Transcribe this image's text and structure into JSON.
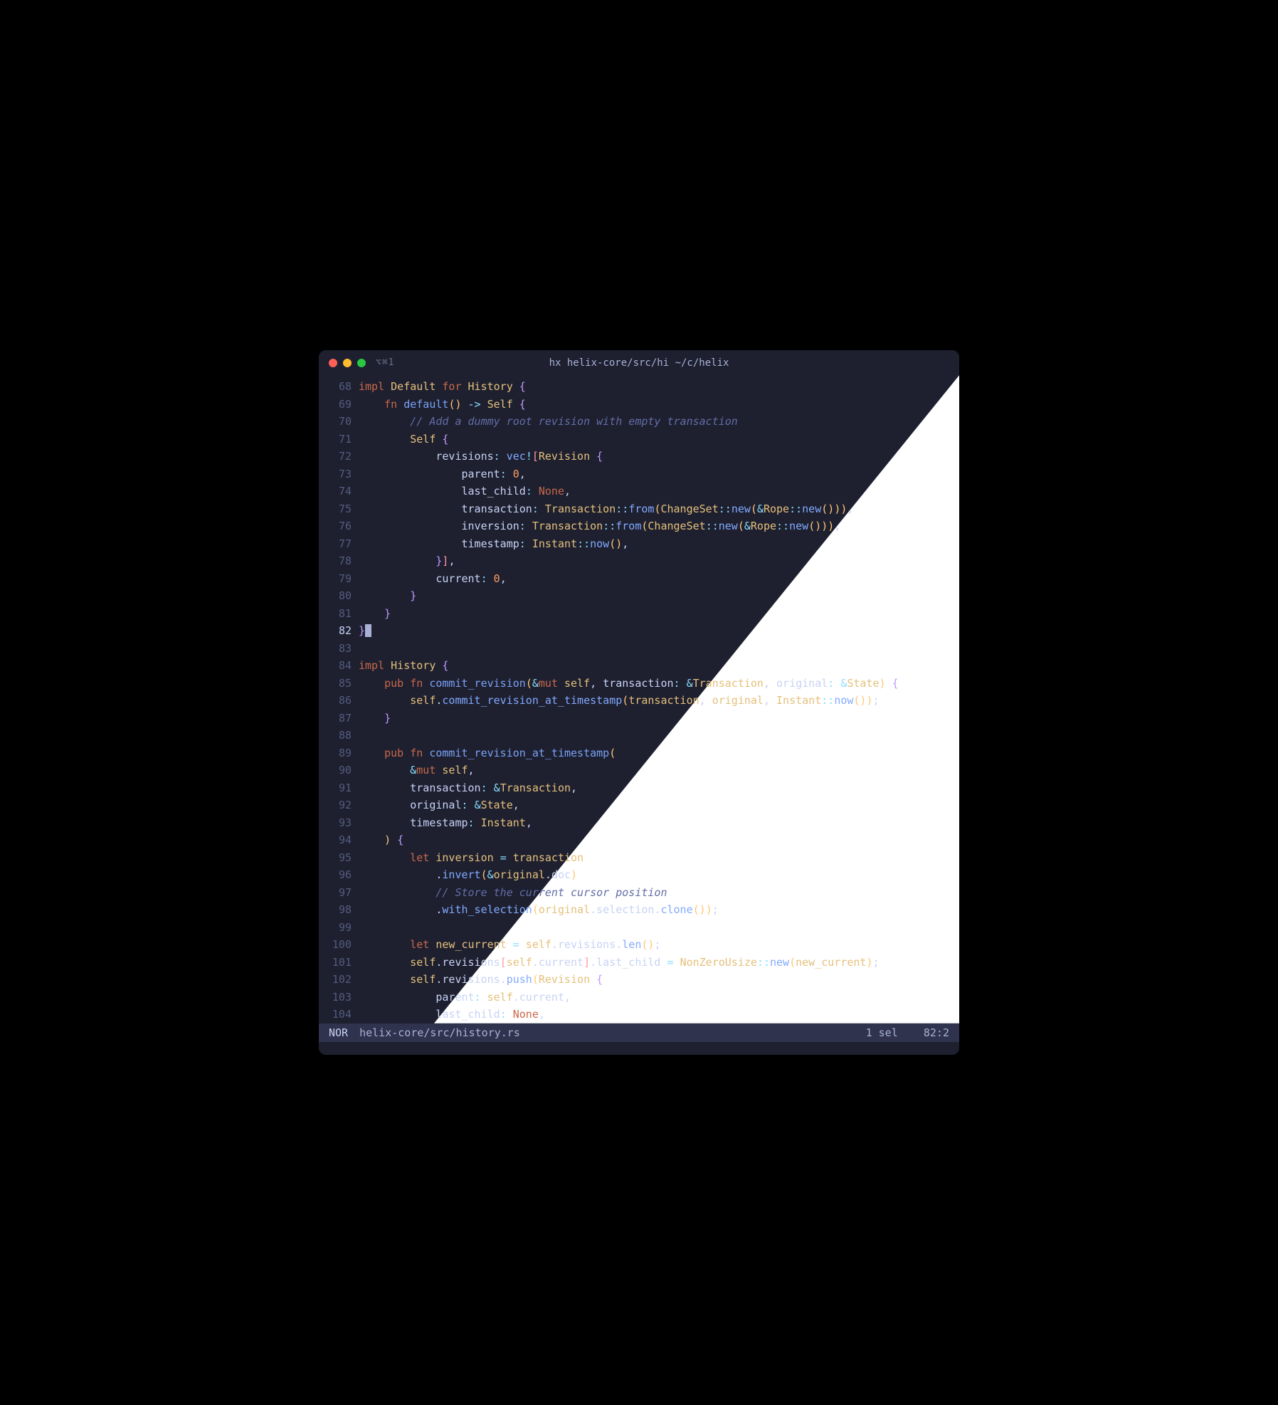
{
  "window": {
    "tab_indicator": "⌥⌘1",
    "title": "hx helix-core/src/hi ~/c/helix"
  },
  "statusbar": {
    "mode": "NOR",
    "filepath": "helix-core/src/history.rs",
    "selections": "1 sel",
    "position": "82:2"
  },
  "lines": [
    {
      "num": "68",
      "tokens": [
        [
          "kw",
          "impl"
        ],
        [
          "",
          " "
        ],
        [
          "ty",
          "Default"
        ],
        [
          "",
          " "
        ],
        [
          "kw",
          "for"
        ],
        [
          "",
          " "
        ],
        [
          "ty",
          "History"
        ],
        [
          "",
          " "
        ],
        [
          "brace",
          "{"
        ]
      ]
    },
    {
      "num": "69",
      "tokens": [
        [
          "",
          "    "
        ],
        [
          "kw",
          "fn"
        ],
        [
          "",
          " "
        ],
        [
          "fnname",
          "default"
        ],
        [
          "paren",
          "()"
        ],
        [
          "",
          " "
        ],
        [
          "punct",
          "->"
        ],
        [
          "",
          " "
        ],
        [
          "ty",
          "Self"
        ],
        [
          "",
          " "
        ],
        [
          "brace",
          "{"
        ]
      ]
    },
    {
      "num": "70",
      "tokens": [
        [
          "",
          "        "
        ],
        [
          "comment",
          "// Add a dummy root revision with empty transaction"
        ]
      ]
    },
    {
      "num": "71",
      "tokens": [
        [
          "",
          "        "
        ],
        [
          "ty",
          "Self"
        ],
        [
          "",
          " "
        ],
        [
          "brace",
          "{"
        ]
      ]
    },
    {
      "num": "72",
      "tokens": [
        [
          "",
          "            "
        ],
        [
          "field",
          "revisions"
        ],
        [
          "punct",
          ":"
        ],
        [
          "",
          " "
        ],
        [
          "fncall",
          "vec"
        ],
        [
          "punct",
          "!"
        ],
        [
          "bracket",
          "["
        ],
        [
          "ty",
          "Revision"
        ],
        [
          "",
          " "
        ],
        [
          "brace",
          "{"
        ]
      ]
    },
    {
      "num": "73",
      "tokens": [
        [
          "",
          "                "
        ],
        [
          "field",
          "parent"
        ],
        [
          "punct",
          ":"
        ],
        [
          "",
          " "
        ],
        [
          "num",
          "0"
        ],
        [
          "",
          ","
        ]
      ]
    },
    {
      "num": "74",
      "tokens": [
        [
          "",
          "                "
        ],
        [
          "field",
          "last_child"
        ],
        [
          "punct",
          ":"
        ],
        [
          "",
          " "
        ],
        [
          "none",
          "None"
        ],
        [
          "",
          ","
        ]
      ]
    },
    {
      "num": "75",
      "tokens": [
        [
          "",
          "                "
        ],
        [
          "field",
          "transaction"
        ],
        [
          "punct",
          ":"
        ],
        [
          "",
          " "
        ],
        [
          "ty",
          "Transaction"
        ],
        [
          "punct",
          "::"
        ],
        [
          "fncall",
          "from"
        ],
        [
          "paren",
          "("
        ],
        [
          "ty",
          "ChangeSet"
        ],
        [
          "punct",
          "::"
        ],
        [
          "fncall",
          "new"
        ],
        [
          "paren",
          "("
        ],
        [
          "punct",
          "&"
        ],
        [
          "ty",
          "Rope"
        ],
        [
          "punct",
          "::"
        ],
        [
          "fncall",
          "new"
        ],
        [
          "paren",
          "()"
        ],
        [
          "paren",
          ")"
        ],
        [
          "paren",
          ")"
        ],
        [
          "",
          ","
        ]
      ]
    },
    {
      "num": "76",
      "tokens": [
        [
          "",
          "                "
        ],
        [
          "field",
          "inversion"
        ],
        [
          "punct",
          ":"
        ],
        [
          "",
          " "
        ],
        [
          "ty",
          "Transaction"
        ],
        [
          "punct",
          "::"
        ],
        [
          "fncall",
          "from"
        ],
        [
          "paren",
          "("
        ],
        [
          "ty",
          "ChangeSet"
        ],
        [
          "punct",
          "::"
        ],
        [
          "fncall",
          "new"
        ],
        [
          "paren",
          "("
        ],
        [
          "punct",
          "&"
        ],
        [
          "ty",
          "Rope"
        ],
        [
          "punct",
          "::"
        ],
        [
          "fncall",
          "new"
        ],
        [
          "paren",
          "()"
        ],
        [
          "paren",
          ")"
        ],
        [
          "paren",
          ")"
        ],
        [
          "",
          ","
        ]
      ]
    },
    {
      "num": "77",
      "tokens": [
        [
          "",
          "                "
        ],
        [
          "field",
          "timestamp"
        ],
        [
          "punct",
          ":"
        ],
        [
          "",
          " "
        ],
        [
          "ty",
          "Instant"
        ],
        [
          "punct",
          "::"
        ],
        [
          "fncall",
          "now"
        ],
        [
          "paren",
          "()"
        ],
        [
          "",
          ","
        ]
      ]
    },
    {
      "num": "78",
      "tokens": [
        [
          "",
          "            "
        ],
        [
          "brace",
          "}"
        ],
        [
          "bracket",
          "]"
        ],
        [
          "",
          ","
        ]
      ]
    },
    {
      "num": "79",
      "tokens": [
        [
          "",
          "            "
        ],
        [
          "field",
          "current"
        ],
        [
          "punct",
          ":"
        ],
        [
          "",
          " "
        ],
        [
          "num",
          "0"
        ],
        [
          "",
          ","
        ]
      ]
    },
    {
      "num": "80",
      "tokens": [
        [
          "",
          "        "
        ],
        [
          "brace",
          "}"
        ]
      ]
    },
    {
      "num": "81",
      "tokens": [
        [
          "",
          "    "
        ],
        [
          "brace",
          "}"
        ]
      ]
    },
    {
      "num": "82",
      "cursor": true,
      "tokens": [
        [
          "brace",
          "}"
        ],
        [
          "cursor",
          " "
        ]
      ]
    },
    {
      "num": "83",
      "tokens": []
    },
    {
      "num": "84",
      "tokens": [
        [
          "kw",
          "impl"
        ],
        [
          "",
          " "
        ],
        [
          "ty",
          "History"
        ],
        [
          "",
          " "
        ],
        [
          "brace",
          "{"
        ]
      ]
    },
    {
      "num": "85",
      "tokens": [
        [
          "",
          "    "
        ],
        [
          "kw",
          "pub"
        ],
        [
          "",
          " "
        ],
        [
          "kw",
          "fn"
        ],
        [
          "",
          " "
        ],
        [
          "fnname",
          "commit_revision"
        ],
        [
          "paren",
          "("
        ],
        [
          "punct",
          "&"
        ],
        [
          "kw",
          "mut"
        ],
        [
          "",
          " "
        ],
        [
          "slf",
          "self"
        ],
        [
          "",
          ","
        ],
        [
          "",
          " "
        ],
        [
          "field",
          "transaction"
        ],
        [
          "punct",
          ":"
        ],
        [
          "",
          " "
        ],
        [
          "punct",
          "&"
        ],
        [
          "ty",
          "Transaction"
        ],
        [
          "",
          ","
        ],
        [
          "",
          " "
        ],
        [
          "field",
          "original"
        ],
        [
          "punct",
          ":"
        ],
        [
          "",
          " "
        ],
        [
          "punct",
          "&"
        ],
        [
          "ty",
          "State"
        ],
        [
          "paren",
          ")"
        ],
        [
          "",
          " "
        ],
        [
          "brace",
          "{"
        ]
      ]
    },
    {
      "num": "86",
      "tokens": [
        [
          "",
          "        "
        ],
        [
          "slf",
          "self"
        ],
        [
          "",
          "."
        ],
        [
          "fncall",
          "commit_revision_at_timestamp"
        ],
        [
          "paren",
          "("
        ],
        [
          "var",
          "transaction"
        ],
        [
          "",
          ","
        ],
        [
          "",
          " "
        ],
        [
          "var",
          "original"
        ],
        [
          "",
          ","
        ],
        [
          "",
          " "
        ],
        [
          "ty",
          "Instant"
        ],
        [
          "punct",
          "::"
        ],
        [
          "fncall",
          "now"
        ],
        [
          "paren",
          "()"
        ],
        [
          "paren",
          ")"
        ],
        [
          "",
          ";"
        ]
      ]
    },
    {
      "num": "87",
      "tokens": [
        [
          "",
          "    "
        ],
        [
          "brace",
          "}"
        ]
      ]
    },
    {
      "num": "88",
      "tokens": []
    },
    {
      "num": "89",
      "tokens": [
        [
          "",
          "    "
        ],
        [
          "kw",
          "pub"
        ],
        [
          "",
          " "
        ],
        [
          "kw",
          "fn"
        ],
        [
          "",
          " "
        ],
        [
          "fnname",
          "commit_revision_at_timestamp"
        ],
        [
          "paren",
          "("
        ]
      ]
    },
    {
      "num": "90",
      "tokens": [
        [
          "",
          "        "
        ],
        [
          "punct",
          "&"
        ],
        [
          "kw",
          "mut"
        ],
        [
          "",
          " "
        ],
        [
          "slf",
          "self"
        ],
        [
          "",
          ","
        ]
      ]
    },
    {
      "num": "91",
      "tokens": [
        [
          "",
          "        "
        ],
        [
          "field",
          "transaction"
        ],
        [
          "punct",
          ":"
        ],
        [
          "",
          " "
        ],
        [
          "punct",
          "&"
        ],
        [
          "ty",
          "Transaction"
        ],
        [
          "",
          ","
        ]
      ]
    },
    {
      "num": "92",
      "tokens": [
        [
          "",
          "        "
        ],
        [
          "field",
          "original"
        ],
        [
          "punct",
          ":"
        ],
        [
          "",
          " "
        ],
        [
          "punct",
          "&"
        ],
        [
          "ty",
          "State"
        ],
        [
          "",
          ","
        ]
      ]
    },
    {
      "num": "93",
      "tokens": [
        [
          "",
          "        "
        ],
        [
          "field",
          "timestamp"
        ],
        [
          "punct",
          ":"
        ],
        [
          "",
          " "
        ],
        [
          "ty",
          "Instant"
        ],
        [
          "",
          ","
        ]
      ]
    },
    {
      "num": "94",
      "tokens": [
        [
          "",
          "    "
        ],
        [
          "paren",
          ")"
        ],
        [
          "",
          " "
        ],
        [
          "brace",
          "{"
        ]
      ]
    },
    {
      "num": "95",
      "tokens": [
        [
          "",
          "        "
        ],
        [
          "kw",
          "let"
        ],
        [
          "",
          " "
        ],
        [
          "var",
          "inversion"
        ],
        [
          "",
          " "
        ],
        [
          "punct",
          "="
        ],
        [
          "",
          " "
        ],
        [
          "var",
          "transaction"
        ]
      ]
    },
    {
      "num": "96",
      "tokens": [
        [
          "",
          "            "
        ],
        [
          "",
          "."
        ],
        [
          "fncall",
          "invert"
        ],
        [
          "paren",
          "("
        ],
        [
          "punct",
          "&"
        ],
        [
          "var",
          "original"
        ],
        [
          "",
          "."
        ],
        [
          "field",
          "doc"
        ],
        [
          "paren",
          ")"
        ]
      ]
    },
    {
      "num": "97",
      "tokens": [
        [
          "",
          "            "
        ],
        [
          "comment",
          "// Store the current cursor position"
        ]
      ]
    },
    {
      "num": "98",
      "tokens": [
        [
          "",
          "            "
        ],
        [
          "",
          "."
        ],
        [
          "fncall",
          "with_selection"
        ],
        [
          "paren",
          "("
        ],
        [
          "var",
          "original"
        ],
        [
          "",
          "."
        ],
        [
          "field",
          "selection"
        ],
        [
          "",
          "."
        ],
        [
          "fncall",
          "clone"
        ],
        [
          "paren",
          "()"
        ],
        [
          "paren",
          ")"
        ],
        [
          "",
          ";"
        ]
      ]
    },
    {
      "num": "99",
      "tokens": []
    },
    {
      "num": "100",
      "tokens": [
        [
          "",
          "        "
        ],
        [
          "kw",
          "let"
        ],
        [
          "",
          " "
        ],
        [
          "var",
          "new_current"
        ],
        [
          "",
          " "
        ],
        [
          "punct",
          "="
        ],
        [
          "",
          " "
        ],
        [
          "slf",
          "self"
        ],
        [
          "",
          "."
        ],
        [
          "field",
          "revisions"
        ],
        [
          "",
          "."
        ],
        [
          "fncall",
          "len"
        ],
        [
          "paren",
          "()"
        ],
        [
          "",
          ";"
        ]
      ]
    },
    {
      "num": "101",
      "tokens": [
        [
          "",
          "        "
        ],
        [
          "slf",
          "self"
        ],
        [
          "",
          "."
        ],
        [
          "field",
          "revisions"
        ],
        [
          "bracket",
          "["
        ],
        [
          "slf",
          "self"
        ],
        [
          "",
          "."
        ],
        [
          "field",
          "current"
        ],
        [
          "bracket",
          "]"
        ],
        [
          "",
          "."
        ],
        [
          "field",
          "last_child"
        ],
        [
          "",
          " "
        ],
        [
          "punct",
          "="
        ],
        [
          "",
          " "
        ],
        [
          "ty",
          "NonZeroUsize"
        ],
        [
          "punct",
          "::"
        ],
        [
          "fncall",
          "new"
        ],
        [
          "paren",
          "("
        ],
        [
          "var",
          "new_current"
        ],
        [
          "paren",
          ")"
        ],
        [
          "",
          ";"
        ]
      ]
    },
    {
      "num": "102",
      "tokens": [
        [
          "",
          "        "
        ],
        [
          "slf",
          "self"
        ],
        [
          "",
          "."
        ],
        [
          "field",
          "revisions"
        ],
        [
          "",
          "."
        ],
        [
          "fncall",
          "push"
        ],
        [
          "paren",
          "("
        ],
        [
          "ty",
          "Revision"
        ],
        [
          "",
          " "
        ],
        [
          "brace",
          "{"
        ]
      ]
    },
    {
      "num": "103",
      "tokens": [
        [
          "",
          "            "
        ],
        [
          "field",
          "parent"
        ],
        [
          "punct",
          ":"
        ],
        [
          "",
          " "
        ],
        [
          "slf",
          "self"
        ],
        [
          "",
          "."
        ],
        [
          "field",
          "current"
        ],
        [
          "",
          ","
        ]
      ]
    },
    {
      "num": "104",
      "tokens": [
        [
          "",
          "            "
        ],
        [
          "field",
          "last_child"
        ],
        [
          "punct",
          ":"
        ],
        [
          "",
          " "
        ],
        [
          "none",
          "None"
        ],
        [
          "",
          ","
        ]
      ]
    }
  ]
}
